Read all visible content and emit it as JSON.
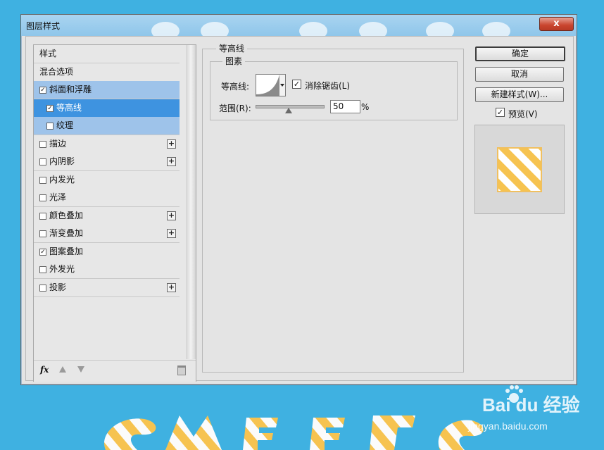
{
  "dialog": {
    "title": "图层样式",
    "close_label": "x"
  },
  "style_list": {
    "items": [
      {
        "label": "样式",
        "checkbox": false,
        "checked": false,
        "plus": false,
        "state": "normal"
      },
      {
        "label": "混合选项",
        "checkbox": false,
        "checked": false,
        "plus": false,
        "state": "normal"
      },
      {
        "label": "斜面和浮雕",
        "checkbox": true,
        "checked": true,
        "plus": false,
        "state": "selected-light"
      },
      {
        "label": "等高线",
        "checkbox": true,
        "checked": true,
        "plus": false,
        "state": "selected"
      },
      {
        "label": "纹理",
        "checkbox": true,
        "checked": false,
        "plus": false,
        "state": "selected-light"
      },
      {
        "label": "描边",
        "checkbox": true,
        "checked": false,
        "plus": true,
        "state": "normal"
      },
      {
        "label": "内阴影",
        "checkbox": true,
        "checked": false,
        "plus": true,
        "state": "normal"
      },
      {
        "label": "内发光",
        "checkbox": true,
        "checked": false,
        "plus": false,
        "state": "normal"
      },
      {
        "label": "光泽",
        "checkbox": true,
        "checked": false,
        "plus": false,
        "state": "normal"
      },
      {
        "label": "颜色叠加",
        "checkbox": true,
        "checked": false,
        "plus": true,
        "state": "normal"
      },
      {
        "label": "渐变叠加",
        "checkbox": true,
        "checked": false,
        "plus": true,
        "state": "normal"
      },
      {
        "label": "图案叠加",
        "checkbox": true,
        "checked": true,
        "plus": false,
        "state": "normal"
      },
      {
        "label": "外发光",
        "checkbox": true,
        "checked": false,
        "plus": false,
        "state": "normal"
      },
      {
        "label": "投影",
        "checkbox": true,
        "checked": false,
        "plus": true,
        "state": "normal"
      }
    ],
    "footer": {
      "fx_label": "fx"
    }
  },
  "contour_panel": {
    "group_title": "等高线",
    "elements_title": "图素",
    "contour_label": "等高线:",
    "anti_alias_label": "消除锯齿(L)",
    "anti_alias_checked": true,
    "range_label": "范围(R):",
    "range_value": "50",
    "range_unit": "%"
  },
  "buttons": {
    "ok": "确定",
    "cancel": "取消",
    "new_style": "新建样式(W)...",
    "preview_label": "预览(V)",
    "preview_checked": true
  },
  "watermark": {
    "brand": "Bai du 经验",
    "url": "jingyan.baidu.com"
  },
  "colors": {
    "background": "#3fb1e1",
    "selection_strong": "#3e93e0",
    "selection_light": "#9ec3ea",
    "close_button": "#c9452f",
    "stripe_yellow": "#f6c350"
  }
}
